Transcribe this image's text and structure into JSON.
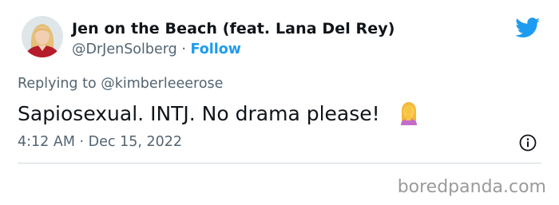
{
  "tweet": {
    "author": {
      "display_name": "Jen on the Beach (feat. Lana Del Rey)",
      "handle": "@DrJenSolberg",
      "separator": "·",
      "follow_label": "Follow"
    },
    "replying_prefix": "Replying to ",
    "replying_to": "@kimberleeerose",
    "text": "Sapiosexual. INTJ. No drama please!",
    "emoji": "woman-facepalming",
    "time": "4:12 AM",
    "date_separator": "·",
    "date": "Dec 15, 2022",
    "icons": {
      "brand": "twitter-bird-icon",
      "info": "info-icon"
    },
    "colors": {
      "accent": "#1d9bf0",
      "secondary_text": "#536471",
      "primary_text": "#0f1419",
      "divider": "#cfd9de"
    }
  },
  "watermark": "boredpanda.com"
}
